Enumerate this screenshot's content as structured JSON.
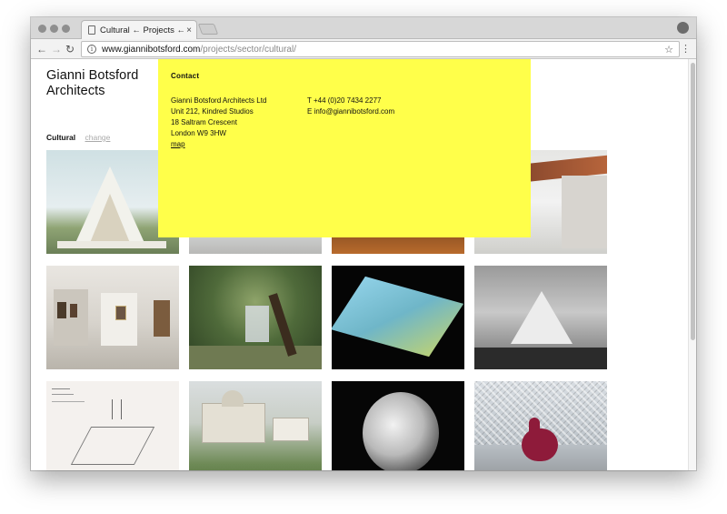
{
  "browser": {
    "tab_title": "Cultural ← Projects ←Gianni B",
    "tab_close": "×",
    "url_host": "www.giannibotsford.com",
    "url_path": "/projects/sector/cultural/",
    "back_glyph": "←",
    "forward_glyph": "→",
    "reload_glyph": "↻",
    "info_glyph": "i",
    "star_glyph": "☆",
    "menu_glyph": "⋮"
  },
  "site": {
    "logo_line1": "Gianni Botsford",
    "logo_line2": "Architects"
  },
  "filter": {
    "current": "Cultural",
    "change_label": "change"
  },
  "contact": {
    "heading": "Contact",
    "address": [
      "Gianni Botsford Architects Ltd",
      "Unit 212, Kindred Studios",
      "18 Saltram Crescent",
      "London W9 3HW"
    ],
    "map_label": "map",
    "phone": "T +44 (0)20 7434 2277",
    "email": "E info@giannibotsford.com"
  },
  "colors": {
    "contact_bg": "#ffff4a",
    "link_gray": "#aaaaaa"
  },
  "projects": [
    {
      "icon": "project-thumbnail-a-frame-pavilion"
    },
    {
      "icon": "project-thumbnail-plaza"
    },
    {
      "icon": "project-thumbnail-interior-night"
    },
    {
      "icon": "project-thumbnail-canopy-roof"
    },
    {
      "icon": "project-thumbnail-gallery-interior"
    },
    {
      "icon": "project-thumbnail-glass-cube-trees"
    },
    {
      "icon": "project-thumbnail-model-on-black"
    },
    {
      "icon": "project-thumbnail-tent-structure-bw"
    },
    {
      "icon": "project-thumbnail-sketch-drawing"
    },
    {
      "icon": "project-thumbnail-aerial-campus"
    },
    {
      "icon": "project-thumbnail-faceted-sphere"
    },
    {
      "icon": "project-thumbnail-lattice-roof-balloon-dog"
    }
  ]
}
